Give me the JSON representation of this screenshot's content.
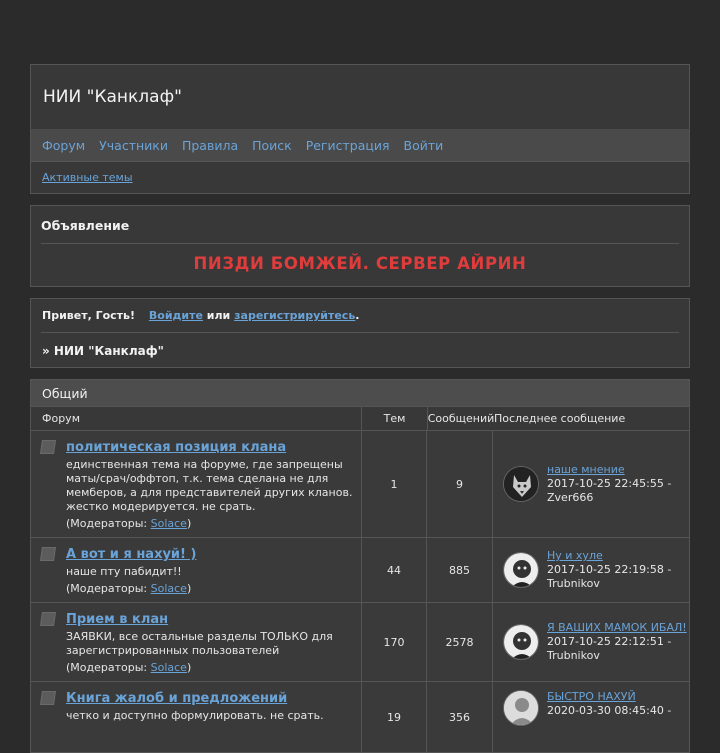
{
  "site": {
    "title": "НИИ \"Канклаф\""
  },
  "nav": {
    "items": [
      "Форум",
      "Участники",
      "Правила",
      "Поиск",
      "Регистрация",
      "Войти"
    ],
    "sub": "Активные темы"
  },
  "announcement": {
    "heading": "Объявление",
    "message": "ПИЗДИ БОМЖЕЙ. СЕРВЕР АЙРИН"
  },
  "welcome": {
    "greeting": "Привет, Гость!",
    "login": "Войдите",
    "or": "или",
    "register": "зарегистрируйтесь",
    "period": ".",
    "breadcrumb": "» НИИ \"Канклаф\""
  },
  "category": {
    "name": "Общий",
    "columns": {
      "forum": "Форум",
      "topics": "Тем",
      "posts": "Сообщений",
      "last": "Последнее сообщение"
    },
    "mods_label": "(Модераторы: ",
    "mods_close": ")",
    "forums": [
      {
        "title": "политическая позиция клана",
        "desc": "единственная тема на форуме, где запрещены маты/срач/оффтоп, т.к. тема сделана не для мемберов, а для представителей других кланов. жестко модерируется. не срать.",
        "moderator": "Solace",
        "topics": "1",
        "posts": "9",
        "last_title": "наше мнение",
        "last_date": "2017-10-25 22:45:55 -",
        "last_user": "Zver666",
        "avatar_icon": "wolf-avatar-icon"
      },
      {
        "title": "А вот и я нахуй! )",
        "desc": "наше пту пабидит!!",
        "moderator": "Solace",
        "topics": "44",
        "posts": "885",
        "last_title": "Ну и хуле",
        "last_date": "2017-10-25 22:19:58 -",
        "last_user": "Trubnikov",
        "avatar_icon": "face-avatar-icon"
      },
      {
        "title": "Прием в клан",
        "desc": "ЗАЯВКИ, все остальные разделы ТОЛЬКО для зарегистрированных пользователей",
        "moderator": "Solace",
        "topics": "170",
        "posts": "2578",
        "last_title": "Я ВАШИХ МАМОК ИБАЛ!",
        "last_date": "2017-10-25 22:12:51 -",
        "last_user": "Trubnikov",
        "avatar_icon": "face-avatar-icon"
      },
      {
        "title": "Книга жалоб и предложений",
        "desc": "четко и доступно формулировать. не срать.",
        "moderator": "",
        "topics": "19",
        "posts": "356",
        "last_title": "БЫСТРО НАХУЙ",
        "last_date": "2020-03-30 08:45:40 -",
        "last_user": "",
        "avatar_icon": "default-user-avatar-icon"
      }
    ]
  }
}
